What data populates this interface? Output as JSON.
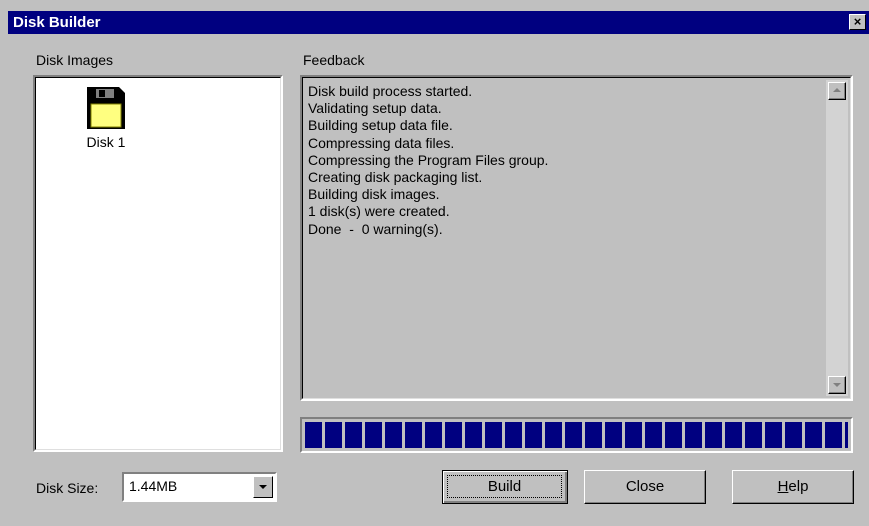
{
  "window": {
    "title": "Disk Builder",
    "close_glyph": "×"
  },
  "disk_images": {
    "label": "Disk Images",
    "items": [
      {
        "label": "Disk 1",
        "icon": "floppy-disk-icon"
      }
    ]
  },
  "feedback": {
    "label": "Feedback",
    "lines": [
      "Disk build process started.",
      "Validating setup data.",
      "Building setup data file.",
      "Compressing data files.",
      "Compressing the Program Files group.",
      "Creating disk packaging list.",
      "Building disk images.",
      "1 disk(s) were created.",
      "Done  -  0 warning(s)."
    ]
  },
  "progress": {
    "fraction": 1.0,
    "fill_color": "#000080"
  },
  "disk_size": {
    "label": "Disk Size:",
    "value": "1.44MB"
  },
  "buttons": {
    "build": "Build",
    "close": "Close",
    "help_mnemonic": "H",
    "help_rest": "elp"
  },
  "colors": {
    "titlebar": "#000080",
    "face": "#c0c0c0",
    "disk_body": "#ffff80"
  }
}
